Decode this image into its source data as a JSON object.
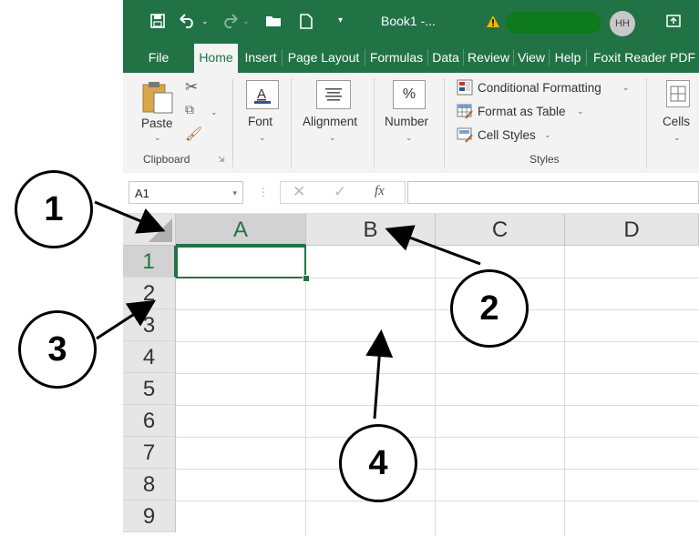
{
  "titlebar": {
    "doc_title": "Book1 -...",
    "avatar": "HH"
  },
  "tabs": [
    "File",
    "Home",
    "Insert",
    "Page Layout",
    "Formulas",
    "Data",
    "Review",
    "View",
    "Help",
    "Foxit Reader PDF"
  ],
  "ribbon": {
    "clipboard": {
      "paste": "Paste",
      "label": "Clipboard"
    },
    "font": "Font",
    "alignment": "Alignment",
    "number": "Number",
    "styles": {
      "conditional": "Conditional Formatting",
      "format_table": "Format as Table",
      "cell_styles": "Cell Styles",
      "label": "Styles"
    },
    "cells": "Cells"
  },
  "formula_bar": {
    "name_box": "A1",
    "fx": "fx"
  },
  "grid": {
    "columns": [
      "A",
      "B",
      "C",
      "D"
    ],
    "rows": [
      "1",
      "2",
      "3",
      "4",
      "5",
      "6",
      "7",
      "8",
      "9"
    ],
    "active_cell": "A1"
  },
  "callouts": [
    "1",
    "2",
    "3",
    "4"
  ]
}
